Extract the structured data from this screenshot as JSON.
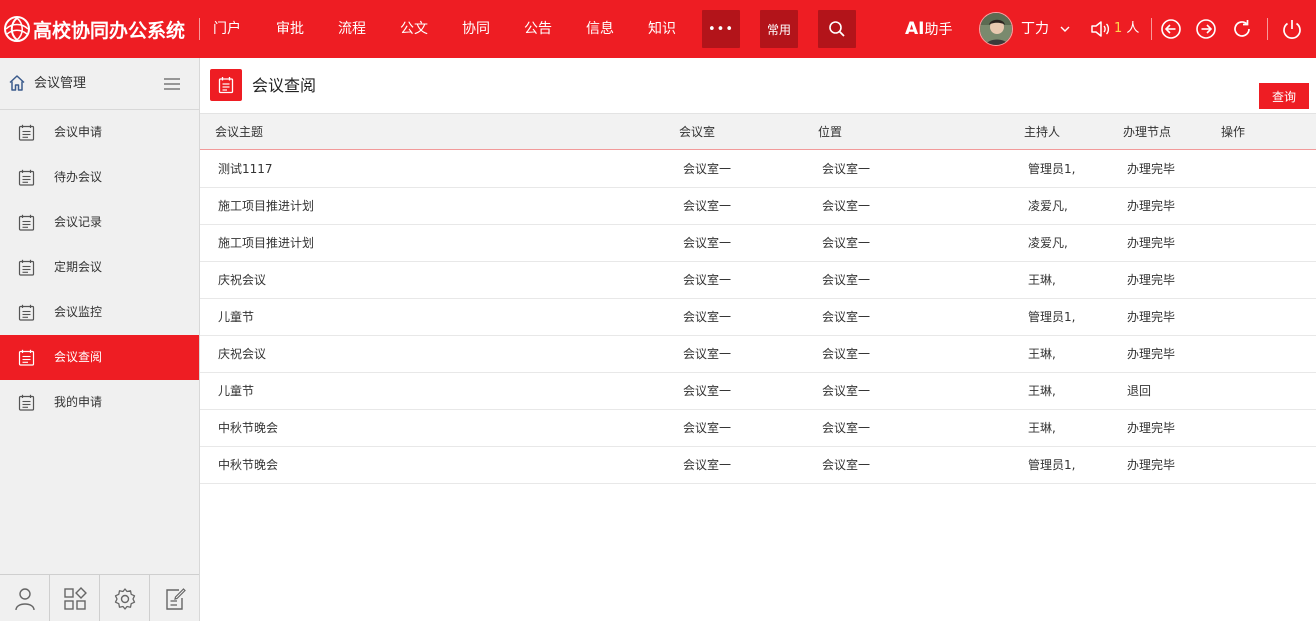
{
  "app": {
    "title": "高校协同办公系统",
    "nav": [
      "门户",
      "审批",
      "流程",
      "公文",
      "协同",
      "公告",
      "信息",
      "知识"
    ],
    "more_label": "•••",
    "common_label": "常用",
    "ai_letters": "AI",
    "ai_label": "助手",
    "user_name": "丁力",
    "online_num": "1",
    "online_unit": "人"
  },
  "sidebar": {
    "title": "会议管理",
    "items": [
      {
        "label": "会议申请"
      },
      {
        "label": "待办会议"
      },
      {
        "label": "会议记录"
      },
      {
        "label": "定期会议"
      },
      {
        "label": "会议监控"
      },
      {
        "label": "会议查阅",
        "active": true
      },
      {
        "label": "我的申请"
      }
    ]
  },
  "main": {
    "title": "会议查阅",
    "query_button": "查询",
    "columns": [
      "会议主题",
      "会议室",
      "位置",
      "主持人",
      "办理节点",
      "操作"
    ],
    "rows": [
      [
        "测试1117",
        "会议室一",
        "会议室一",
        "管理员1,",
        "办理完毕"
      ],
      [
        "施工项目推进计划",
        "会议室一",
        "会议室一",
        "凌爱凡,",
        "办理完毕"
      ],
      [
        "施工项目推进计划",
        "会议室一",
        "会议室一",
        "凌爱凡,",
        "办理完毕"
      ],
      [
        "庆祝会议",
        "会议室一",
        "会议室一",
        "王琳,",
        "办理完毕"
      ],
      [
        "儿童节",
        "会议室一",
        "会议室一",
        "管理员1,",
        "办理完毕"
      ],
      [
        "庆祝会议",
        "会议室一",
        "会议室一",
        "王琳,",
        "办理完毕"
      ],
      [
        "儿童节",
        "会议室一",
        "会议室一",
        "王琳,",
        "退回"
      ],
      [
        "中秋节晚会",
        "会议室一",
        "会议室一",
        "王琳,",
        "办理完毕"
      ],
      [
        "中秋节晚会",
        "会议室一",
        "会议室一",
        "管理员1,",
        "办理完毕"
      ]
    ]
  },
  "colors": {
    "brand_red": "#ee1d23",
    "dark_red": "#b3141a",
    "sidebar_bg": "#f0f0f0"
  },
  "icons": [
    "logo-icon",
    "search-icon",
    "chevron-down-icon",
    "volume-icon",
    "back-icon",
    "forward-icon",
    "refresh-icon",
    "power-icon",
    "home-icon",
    "menu-icon",
    "calendar-icon",
    "user-icon",
    "apps-icon",
    "settings-icon",
    "edit-note-icon"
  ]
}
